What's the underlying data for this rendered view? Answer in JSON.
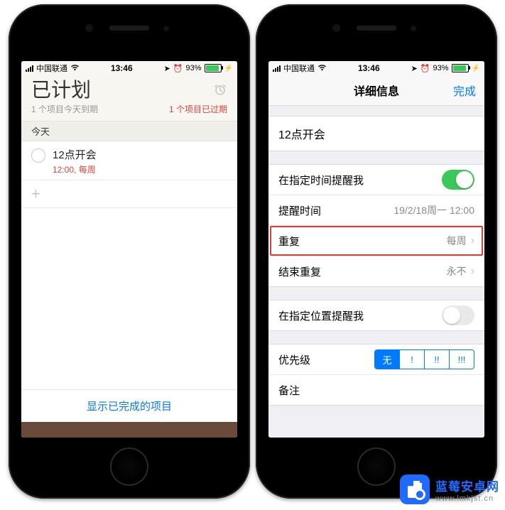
{
  "status": {
    "carrier": "中国联通",
    "time": "13:46",
    "battery_pct": "93%"
  },
  "left": {
    "title": "已计划",
    "subtitle": "1 个项目今天到期",
    "overdue": "1 个项目已过期",
    "section": "今天",
    "reminder": {
      "title": "12点开会",
      "detail": "12:00,  每周"
    },
    "show_completed": "显示已完成的项目"
  },
  "right": {
    "nav_title": "详细信息",
    "done": "完成",
    "item_title": "12点开会",
    "remind_time_label": "在指定时间提醒我",
    "alarm_label": "提醒时间",
    "alarm_value": "19/2/18周一 12:00",
    "repeat_label": "重复",
    "repeat_value": "每周",
    "end_repeat_label": "结束重复",
    "end_repeat_value": "永不",
    "remind_location_label": "在指定位置提醒我",
    "priority_label": "优先级",
    "priority_options": [
      "无",
      "!",
      "!!",
      "!!!"
    ],
    "notes_label": "备注"
  },
  "watermark": {
    "line1": "蓝莓安卓网",
    "line2": "www.lmkjst.cn"
  }
}
